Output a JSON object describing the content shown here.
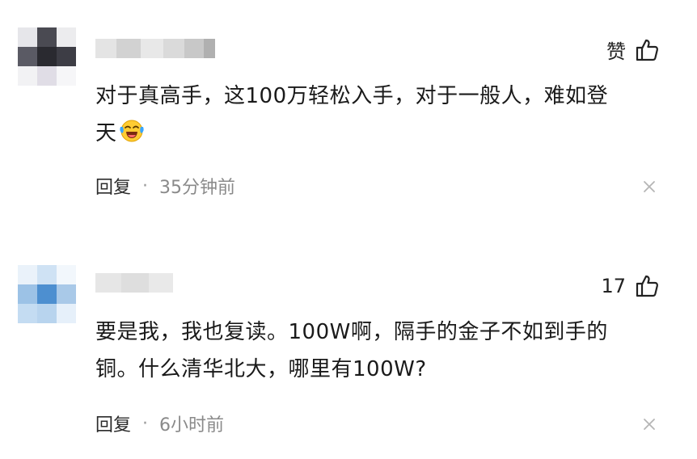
{
  "comments": [
    {
      "like_label": "赞",
      "text_line1": "对于真高手，这100万轻松入手，对于一般人，难如登",
      "text_line2": "天",
      "reply_label": "回复",
      "separator": "·",
      "time": "35分钟前",
      "emoji_icon": "laughing-crying-emoji-icon"
    },
    {
      "like_label": "17",
      "text_line1": "要是我，我也复读。100W啊，隔手的金子不如到手的",
      "text_line2": "铜。什么清华北大，哪里有100W?",
      "reply_label": "回复",
      "separator": "·",
      "time": "6小时前"
    }
  ],
  "colors": {
    "text": "#1a1a1a",
    "meta": "#8a8a8a",
    "icon": "#222222"
  }
}
